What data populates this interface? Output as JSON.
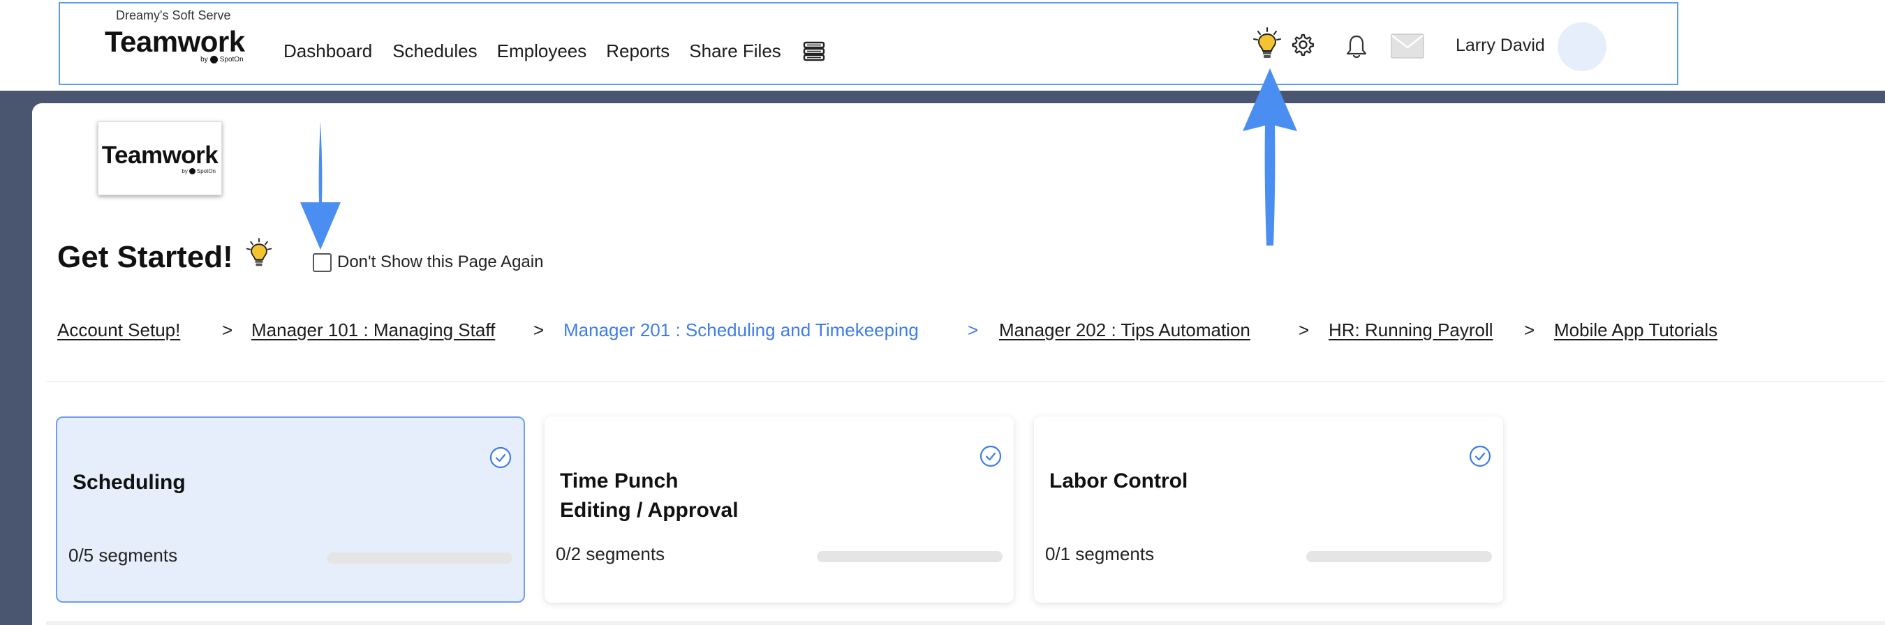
{
  "header": {
    "company": "Dreamy's Soft Serve",
    "logo_word": "Teamwork",
    "logo_by": "by",
    "logo_brand": "SpotOn",
    "nav": [
      {
        "label": "Dashboard"
      },
      {
        "label": "Schedules"
      },
      {
        "label": "Employees"
      },
      {
        "label": "Reports"
      },
      {
        "label": "Share Files"
      }
    ],
    "icons": [
      "stacked-books-icon",
      "lightbulb-icon",
      "gear-icon",
      "bell-icon",
      "mail-icon"
    ],
    "user_name": "Larry David"
  },
  "page": {
    "logo_word": "Teamwork",
    "logo_by": "by",
    "logo_brand": "SpotOn",
    "title": "Get Started!",
    "dont_show_label": "Don't Show this Page Again",
    "dont_show_checked": false
  },
  "breadcrumbs": [
    {
      "label": "Account Setup!",
      "active": false
    },
    {
      "label": "Manager 101 : Managing Staff",
      "active": false
    },
    {
      "label": "Manager 201 : Scheduling and Timekeeping",
      "active": true
    },
    {
      "label": "Manager 202 : Tips Automation",
      "active": false
    },
    {
      "label": "HR: Running Payroll",
      "active": false
    },
    {
      "label": "Mobile App Tutorials",
      "active": false
    }
  ],
  "cards": [
    {
      "title_line1": "Scheduling",
      "title_line2": "",
      "segments": "0/5 segments",
      "progress": 0,
      "selected": true,
      "completed_icon": "check-circle-icon"
    },
    {
      "title_line1": "Time Punch",
      "title_line2": "Editing / Approval",
      "segments": "0/2 segments",
      "progress": 0,
      "selected": false,
      "completed_icon": "check-circle-icon"
    },
    {
      "title_line1": "Labor Control",
      "title_line2": "",
      "segments": "0/1 segments",
      "progress": 0,
      "selected": false,
      "completed_icon": "check-circle-icon"
    }
  ],
  "colors": {
    "accent": "#3f7de6",
    "annotation_arrow": "#4a8ef2",
    "sidebar_dark": "#4a5570",
    "selected_card_bg": "#e7eefb",
    "bulb": "#f4c430"
  }
}
